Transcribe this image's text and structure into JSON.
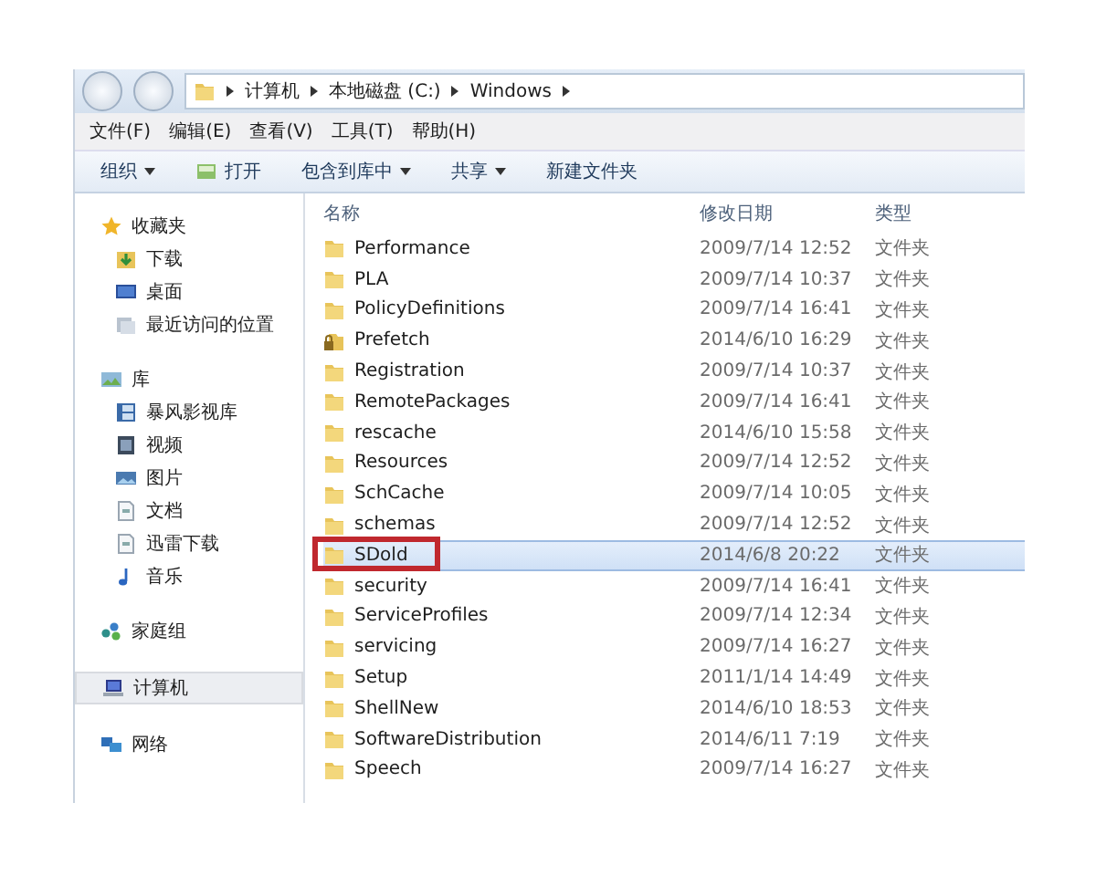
{
  "address": {
    "segments": [
      "计算机",
      "本地磁盘 (C:)",
      "Windows"
    ]
  },
  "menu": [
    "文件(F)",
    "编辑(E)",
    "查看(V)",
    "工具(T)",
    "帮助(H)"
  ],
  "toolbar": [
    {
      "label": "组织",
      "dropdown": true,
      "icon": false
    },
    {
      "label": "打开",
      "dropdown": false,
      "icon": true
    },
    {
      "label": "包含到库中",
      "dropdown": true,
      "icon": false
    },
    {
      "label": "共享",
      "dropdown": true,
      "icon": false
    },
    {
      "label": "新建文件夹",
      "dropdown": false,
      "icon": false
    }
  ],
  "sidebar": {
    "groups": [
      {
        "label": "收藏夹",
        "kind": "star",
        "selected": false,
        "children": [
          {
            "label": "下载",
            "kind": "download",
            "selected": false
          },
          {
            "label": "桌面",
            "kind": "desktop",
            "selected": false
          },
          {
            "label": "最近访问的位置",
            "kind": "recent",
            "selected": false
          }
        ]
      },
      {
        "label": "库",
        "kind": "library",
        "selected": false,
        "children": [
          {
            "label": "暴风影视库",
            "kind": "film",
            "selected": false
          },
          {
            "label": "视频",
            "kind": "video",
            "selected": false
          },
          {
            "label": "图片",
            "kind": "image",
            "selected": false
          },
          {
            "label": "文档",
            "kind": "document",
            "selected": false
          },
          {
            "label": "迅雷下载",
            "kind": "document",
            "selected": false
          },
          {
            "label": "音乐",
            "kind": "music",
            "selected": false
          }
        ]
      },
      {
        "label": "家庭组",
        "kind": "homegroup",
        "selected": false
      },
      {
        "label": "计算机",
        "kind": "computer",
        "selected": true
      },
      {
        "label": "网络",
        "kind": "network",
        "selected": false
      }
    ]
  },
  "table": {
    "columns": [
      "名称",
      "修改日期",
      "类型"
    ],
    "rows": [
      {
        "name": "Performance",
        "date": "2009/7/14 12:52",
        "type": "文件夹",
        "locked": false,
        "selected": false,
        "marked": false
      },
      {
        "name": "PLA",
        "date": "2009/7/14 10:37",
        "type": "文件夹",
        "locked": false,
        "selected": false,
        "marked": false
      },
      {
        "name": "PolicyDefinitions",
        "date": "2009/7/14 16:41",
        "type": "文件夹",
        "locked": false,
        "selected": false,
        "marked": false
      },
      {
        "name": "Prefetch",
        "date": "2014/6/10 16:29",
        "type": "文件夹",
        "locked": true,
        "selected": false,
        "marked": false
      },
      {
        "name": "Registration",
        "date": "2009/7/14 10:37",
        "type": "文件夹",
        "locked": false,
        "selected": false,
        "marked": false
      },
      {
        "name": "RemotePackages",
        "date": "2009/7/14 16:41",
        "type": "文件夹",
        "locked": false,
        "selected": false,
        "marked": false
      },
      {
        "name": "rescache",
        "date": "2014/6/10 15:58",
        "type": "文件夹",
        "locked": false,
        "selected": false,
        "marked": false
      },
      {
        "name": "Resources",
        "date": "2009/7/14 12:52",
        "type": "文件夹",
        "locked": false,
        "selected": false,
        "marked": false
      },
      {
        "name": "SchCache",
        "date": "2009/7/14 10:05",
        "type": "文件夹",
        "locked": false,
        "selected": false,
        "marked": false
      },
      {
        "name": "schemas",
        "date": "2009/7/14 12:52",
        "type": "文件夹",
        "locked": false,
        "selected": false,
        "marked": false
      },
      {
        "name": "SDold",
        "date": "2014/6/8 20:22",
        "type": "文件夹",
        "locked": false,
        "selected": true,
        "marked": true
      },
      {
        "name": "security",
        "date": "2009/7/14 16:41",
        "type": "文件夹",
        "locked": false,
        "selected": false,
        "marked": false
      },
      {
        "name": "ServiceProfiles",
        "date": "2009/7/14 12:34",
        "type": "文件夹",
        "locked": false,
        "selected": false,
        "marked": false
      },
      {
        "name": "servicing",
        "date": "2009/7/14 16:27",
        "type": "文件夹",
        "locked": false,
        "selected": false,
        "marked": false
      },
      {
        "name": "Setup",
        "date": "2011/1/14 14:49",
        "type": "文件夹",
        "locked": false,
        "selected": false,
        "marked": false
      },
      {
        "name": "ShellNew",
        "date": "2014/6/10 18:53",
        "type": "文件夹",
        "locked": false,
        "selected": false,
        "marked": false
      },
      {
        "name": "SoftwareDistribution",
        "date": "2014/6/11 7:19",
        "type": "文件夹",
        "locked": false,
        "selected": false,
        "marked": false
      },
      {
        "name": "Speech",
        "date": "2009/7/14 16:27",
        "type": "文件夹",
        "locked": false,
        "selected": false,
        "marked": false
      }
    ]
  }
}
